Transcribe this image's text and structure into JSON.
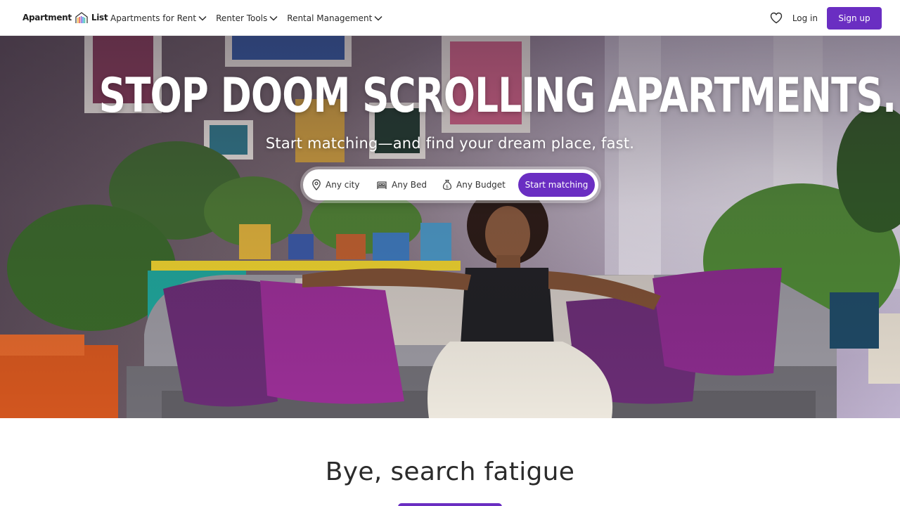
{
  "header": {
    "logo": {
      "word_left": "Apartment",
      "word_right": "List",
      "icon": "rainbow-building-icon"
    },
    "nav_links": [
      {
        "label": "Apartments for Rent",
        "icon": "chevron-down-icon"
      },
      {
        "label": "Renter Tools",
        "icon": "chevron-down-icon"
      },
      {
        "label": "Rental Management",
        "icon": "chevron-down-icon"
      }
    ],
    "favorites_icon": "heart-icon",
    "login_label": "Log in",
    "signup_label": "Sign up"
  },
  "hero": {
    "title": "STOP DOOM SCROLLING APARTMENTS.",
    "subtitle": "Start matching—and find your dream place, fast.",
    "image_icon": "hero-living-room-photo",
    "search": {
      "city": {
        "label": "Any city",
        "icon": "map-pin-icon"
      },
      "bed": {
        "label": "Any Bed",
        "icon": "bed-icon"
      },
      "budget": {
        "label": "Any Budget",
        "icon": "money-bag-icon"
      },
      "submit_label": "Start matching"
    }
  },
  "section": {
    "title": "Bye, search fatigue"
  },
  "colors": {
    "brand_purple": "#6a2ec2",
    "text_dark": "#2b2b2b",
    "white": "#ffffff"
  }
}
